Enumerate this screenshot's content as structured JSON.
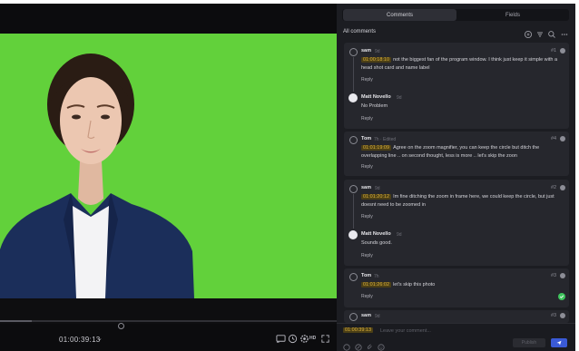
{
  "viewer": {
    "timecode": "01:00:39:13",
    "timecode_caret": "⌄",
    "quality_badge": "HD"
  },
  "panel": {
    "tabs": [
      {
        "label": "Comments",
        "active": true
      },
      {
        "label": "Fields",
        "active": false
      }
    ],
    "filter_label": "All comments"
  },
  "comments": [
    {
      "author": "sam",
      "meta": "9d",
      "number": "#1",
      "timecode": "01:00:18:10",
      "text": "not the biggest fan of the program window. I think just keep it simple with a head shot card and name label",
      "reply_label": "Reply",
      "replies": [
        {
          "author": "Matt Novello",
          "meta": "9d",
          "text": "No Problem",
          "reply_label": "Reply"
        }
      ]
    },
    {
      "author": "Tom",
      "meta": "7h · Edited",
      "number": "#4",
      "timecode": "01:01:19:09",
      "text": "Agree on the zoom magnifier, you can keep the circle but ditch the overlapping line .. on second thought, less is more .. let's skip the zoon",
      "reply_label": "Reply"
    },
    {
      "author": "sam",
      "meta": "9d",
      "number": "#2",
      "timecode": "01:01:20:12",
      "text": "Im fine ditching the zoom in frame here, we could keep the circle, but just doesnt need to be zoomed in",
      "reply_label": "Reply",
      "replies": [
        {
          "author": "Matt Novello",
          "meta": "9d",
          "text": "Sounds good.",
          "reply_label": "Reply"
        }
      ]
    },
    {
      "author": "Tom",
      "meta": "7h",
      "number": "#3",
      "timecode": "01:01:26:02",
      "text": "let's skip this photo",
      "reply_label": "Reply",
      "resolved": true
    },
    {
      "author": "sam",
      "meta": "9d",
      "number": "#3"
    }
  ],
  "composer": {
    "timecode": "01:00:39:13",
    "placeholder": "Leave your comment...",
    "publish_label": "Publish",
    "send_label": "Send"
  },
  "colors": {
    "chroma_green": "#62d13b",
    "panel_bg": "#1c1d22",
    "card_bg": "#26272d",
    "timecode_text": "#e2b53c",
    "timecode_bg": "#4b3f16",
    "resolved_green": "#3ec45c",
    "send_blue": "#3a5ad6"
  },
  "icons": [
    "settings-icon",
    "filter-icon",
    "search-icon",
    "more-icon",
    "cast-icon",
    "clock-icon",
    "settings-hd-icon",
    "fullscreen-icon",
    "pin-icon",
    "draw-icon",
    "attach-icon",
    "emoji-icon",
    "send-icon",
    "check-icon"
  ]
}
